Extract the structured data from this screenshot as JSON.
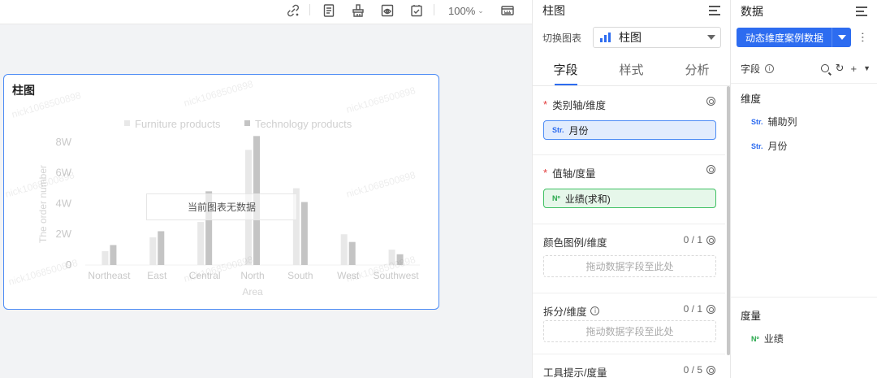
{
  "toolbar": {
    "zoom": "100%",
    "icons": [
      "link-edit-icon",
      "document-icon",
      "clear-format-icon",
      "preview-icon",
      "checklist-icon",
      "keyboard-icon"
    ]
  },
  "card": {
    "title": "柱图",
    "no_data": "当前图表无数据",
    "watermark": "nick1068500898"
  },
  "chart_data": {
    "type": "bar",
    "categories": [
      "Northeast",
      "East",
      "Central",
      "North",
      "South",
      "West",
      "Southwest"
    ],
    "series": [
      {
        "name": "Furniture products",
        "values": [
          9000,
          18000,
          28000,
          75000,
          50000,
          20000,
          10000
        ]
      },
      {
        "name": "Technology products",
        "values": [
          13000,
          22000,
          48000,
          84000,
          41000,
          15000,
          7000
        ]
      }
    ],
    "xlabel": "Area",
    "ylabel": "The order number",
    "yticks": [
      "0",
      "2W",
      "4W",
      "6W",
      "8W"
    ],
    "ylim": [
      0,
      90000
    ],
    "legend": "top-center",
    "grid": false,
    "colors": {
      "furniture": "#e8e8e8",
      "technology": "#c4c4c4"
    }
  },
  "fields_panel": {
    "title": "柱图",
    "switch_label": "切换图表",
    "chart_type": "柱图",
    "tabs": [
      {
        "label": "字段"
      },
      {
        "label": "样式"
      },
      {
        "label": "分析"
      }
    ],
    "sections": {
      "category_axis": {
        "title": "类别轴/维度",
        "field_tag": "Str.",
        "field": "月份"
      },
      "value_axis": {
        "title": "值轴/度量",
        "field_tag": "Nº",
        "field": "业绩(求和)"
      },
      "color_legend": {
        "title": "颜色图例/维度",
        "count": "0 / 1",
        "drop": "拖动数据字段至此处"
      },
      "split": {
        "title": "拆分/维度",
        "count": "0 / 1",
        "drop": "拖动数据字段至此处"
      },
      "tooltip": {
        "title": "工具提示/度量",
        "count": "0 / 5"
      }
    }
  },
  "data_panel": {
    "title": "数据",
    "dataset": "动态维度案例数据",
    "fields_label": "字段",
    "dimension_title": "维度",
    "dimensions": [
      {
        "tag": "Str.",
        "name": "辅助列"
      },
      {
        "tag": "Str.",
        "name": "月份"
      }
    ],
    "measure_title": "度量",
    "measures": [
      {
        "tag": "Nº",
        "name": "业绩"
      }
    ]
  },
  "colors": {
    "accent": "#2d6cf0",
    "card_border": "#4d8cf5",
    "measure": "#27a74a",
    "required": "#e23b3b"
  }
}
